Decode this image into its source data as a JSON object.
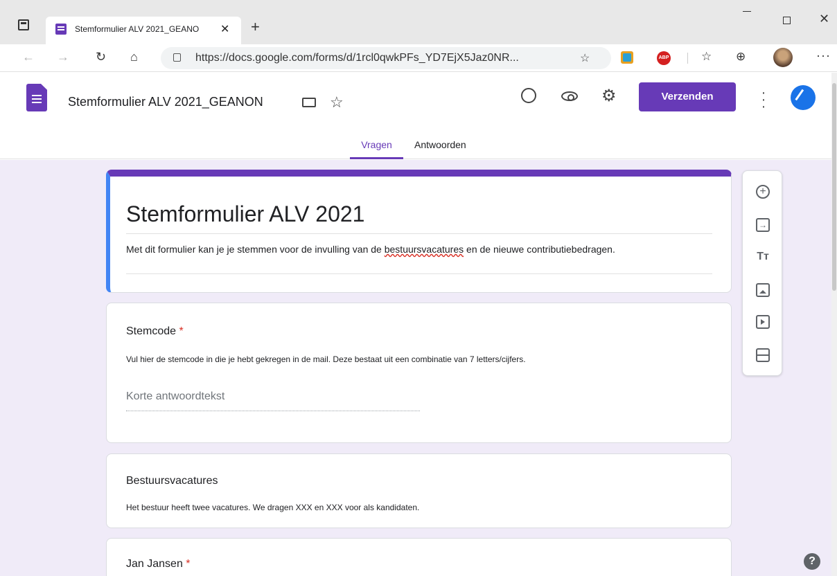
{
  "browser": {
    "tab_title": "Stemformulier ALV 2021_GEANO",
    "tab_close": "✕",
    "new_tab": "+",
    "url": "https://docs.google.com/forms/d/1rcl0qwkPFs_YD7EjX5Jaz0NR...",
    "ext_abp": "ABP",
    "more": "···"
  },
  "app": {
    "doc_title": "Stemformulier ALV 2021_GEANON",
    "send_label": "Verzenden",
    "tabs": [
      {
        "label": "Vragen",
        "active": true
      },
      {
        "label": "Antwoorden",
        "active": false
      }
    ],
    "accent_color": "#673ab7"
  },
  "form": {
    "title": "Stemformulier ALV 2021",
    "description_before": "Met dit formulier kan je je stemmen voor de invulling van de ",
    "description_misspelled": "bestuursvacatures",
    "description_after": " en de nieuwe contributiebedragen.",
    "questions": [
      {
        "title": "Stemcode",
        "required": true,
        "help": "Vul hier de stemcode in die je hebt gekregen in de mail. Deze bestaat uit een combinatie van 7 letters/cijfers.",
        "answer_placeholder": "Korte antwoordtekst"
      },
      {
        "title": "Bestuursvacatures",
        "required": false,
        "help": "Het bestuur heeft twee vacatures. We dragen XXX en XXX voor als kandidaten."
      },
      {
        "title": "Jan Jansen",
        "required": true
      }
    ],
    "required_mark": "*"
  },
  "toolbar": {
    "add": "+",
    "import": "→",
    "text": "Tт"
  },
  "help": "?"
}
